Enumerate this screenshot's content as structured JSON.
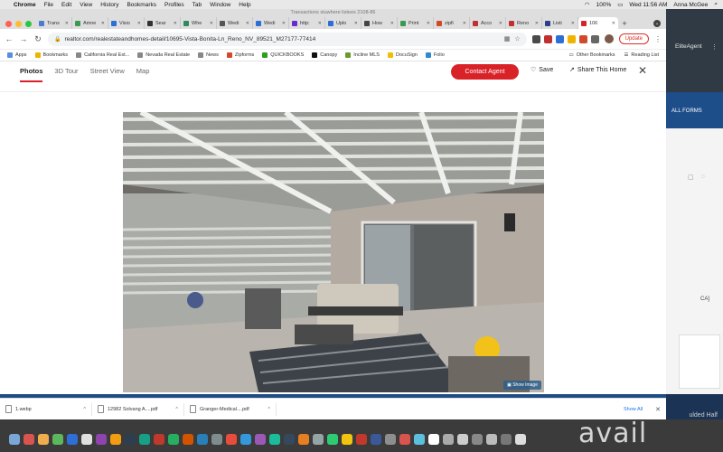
{
  "menubar": {
    "app": "Chrome",
    "items": [
      "File",
      "Edit",
      "View",
      "History",
      "Bookmarks",
      "Profiles",
      "Tab",
      "Window",
      "Help"
    ],
    "battery": "100%",
    "clock": "Wed 11:56 AM",
    "user": "Anna McGee"
  },
  "window_title": "Transactions stuwhere listees 2108-86",
  "tabs": [
    {
      "label": "Trans",
      "color": "#4a7bd0"
    },
    {
      "label": "Amne",
      "color": "#3c9a50"
    },
    {
      "label": "Visio",
      "color": "#2d6fd6"
    },
    {
      "label": "Sear",
      "color": "#333333"
    },
    {
      "label": "Whe",
      "color": "#2d8a5a"
    },
    {
      "label": "Wedi",
      "color": "#555555"
    },
    {
      "label": "Wedi",
      "color": "#2d6fd6"
    },
    {
      "label": "http:",
      "color": "#6a2ad0"
    },
    {
      "label": "Uplo",
      "color": "#2d6fd6"
    },
    {
      "label": "How",
      "color": "#444444"
    },
    {
      "label": "Print",
      "color": "#3c9a50"
    },
    {
      "label": "zipfi",
      "color": "#d04a2a"
    },
    {
      "label": "Acco",
      "color": "#c03030"
    },
    {
      "label": "Reno",
      "color": "#c03030"
    },
    {
      "label": "Listi",
      "color": "#2d3f8a"
    }
  ],
  "active_tab": {
    "label": "106",
    "color": "#d92228"
  },
  "url": "realtor.com/realestateandhomes-detail/10695-Vista-Bonita-Ln_Reno_NV_89521_M27177-77414",
  "update_label": "Update",
  "bookmarks": [
    {
      "label": "Apps",
      "color": "#5a8ee0"
    },
    {
      "label": "Bookmarks",
      "color": "#f0b400"
    },
    {
      "label": "California Real Est...",
      "color": "#888888"
    },
    {
      "label": "Nevada Real Estate",
      "color": "#888888"
    },
    {
      "label": "News",
      "color": "#888888"
    },
    {
      "label": "Zipforms",
      "color": "#d04a2a"
    },
    {
      "label": "QUICKBOOKS",
      "color": "#2ca01c"
    },
    {
      "label": "Canopy",
      "color": "#111111"
    },
    {
      "label": "Incline MLS",
      "color": "#6a9a2a"
    },
    {
      "label": "DocuSign",
      "color": "#f0c000"
    },
    {
      "label": "Folio",
      "color": "#2d8ad0"
    }
  ],
  "bookmarks_right": [
    "Other Bookmarks",
    "Reading List"
  ],
  "page_tabs": [
    "Photos",
    "3D Tour",
    "Street View",
    "Map"
  ],
  "active_page_tab": "Photos",
  "actions": {
    "contact": "Contact Agent",
    "save": "Save",
    "share": "Share This Home"
  },
  "photo": {
    "show_image_label": "Show Image"
  },
  "sideapp": {
    "brand": "EliteAgent",
    "band_label": "ALL FORMS",
    "snippet": "CA]",
    "footer": "ulded Half"
  },
  "downloads": [
    {
      "name": "1.webp"
    },
    {
      "name": "12982 Solvang A....pdf"
    },
    {
      "name": "Granger-Medical....pdf"
    }
  ],
  "show_all": "Show All",
  "watermark": "avail",
  "colors": {
    "accent": "#d92228",
    "link": "#1a73e8"
  }
}
